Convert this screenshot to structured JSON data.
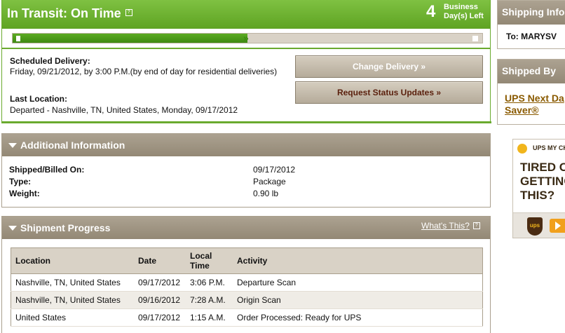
{
  "status": {
    "title": "In Transit: On Time",
    "help_mark": "?",
    "days_left_number": "4",
    "days_left_label": "Business Day(s) Left",
    "progress_fraction": 0.5,
    "scheduled_delivery_label": "Scheduled Delivery:",
    "scheduled_delivery_value": "Friday, 09/21/2012, by 3:00 P.M.(by end of day for residential deliveries)",
    "last_location_label": "Last Location:",
    "last_location_value": "Departed - Nashville, TN, United States, Monday, 09/17/2012",
    "change_delivery_label": "Change Delivery »",
    "request_updates_label": "Request Status Updates »",
    "colors": {
      "header_green": "#6aaa2e",
      "panel_tan": "#a99f8d",
      "link_brown": "#8a5a00"
    }
  },
  "additional": {
    "title": "Additional Information",
    "rows": [
      {
        "label": "Shipped/Billed On:",
        "value": "09/17/2012"
      },
      {
        "label": "Type:",
        "value": "Package"
      },
      {
        "label": "Weight:",
        "value": "0.90 lb"
      }
    ]
  },
  "progress": {
    "title": "Shipment Progress",
    "whats_this": "What's This?",
    "columns": [
      "Location",
      "Date",
      "Local Time",
      "Activity"
    ],
    "rows": [
      [
        "Nashville, TN, United States",
        "09/17/2012",
        "3:06 P.M.",
        "Departure Scan"
      ],
      [
        "Nashville, TN, United States",
        "09/16/2012",
        "7:28 A.M.",
        "Origin Scan"
      ],
      [
        "United States",
        "09/17/2012",
        "1:15 A.M.",
        "Order Processed: Ready for UPS"
      ]
    ]
  },
  "sidebar": {
    "shipping_info_title": "Shipping Info",
    "ship_to": "To:  MARYSV",
    "shipped_by_title": "Shipped By",
    "service_name_line1": "UPS Next Da",
    "service_name_line2": "Saver®"
  },
  "ad": {
    "brand": "UPS MY CH",
    "text_lines": [
      "TIRED OF",
      "GETTING",
      "THIS?"
    ],
    "shield_text": "ups"
  }
}
